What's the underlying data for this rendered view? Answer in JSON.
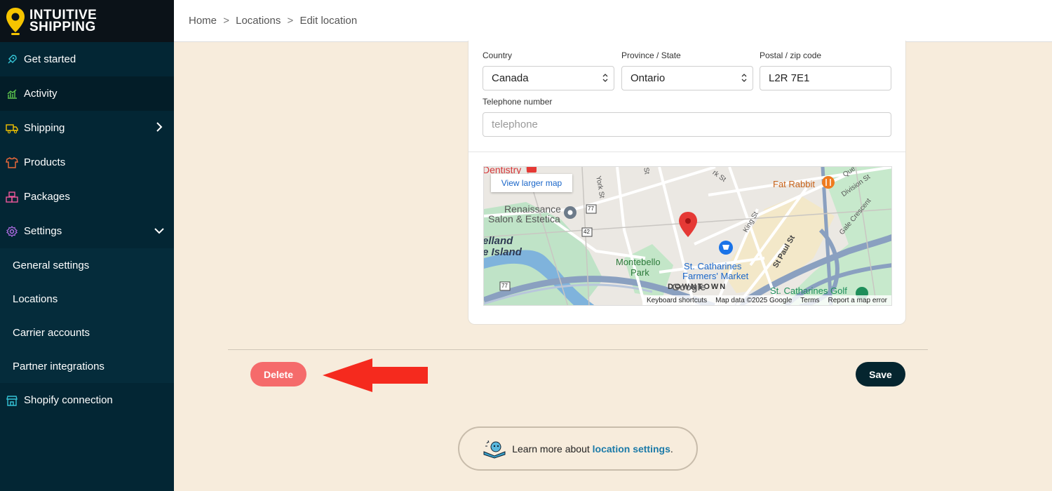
{
  "brand": {
    "line1": "INTUITIVE",
    "line2": "SHIPPING"
  },
  "sidebar": {
    "items": [
      {
        "label": "Get started",
        "icon": "rocket-icon"
      },
      {
        "label": "Activity",
        "icon": "chart-icon"
      },
      {
        "label": "Shipping",
        "icon": "truck-icon"
      },
      {
        "label": "Products",
        "icon": "shirt-icon"
      },
      {
        "label": "Packages",
        "icon": "boxes-icon"
      },
      {
        "label": "Settings",
        "icon": "gear-icon"
      }
    ],
    "subitems": [
      {
        "label": "General settings"
      },
      {
        "label": "Locations"
      },
      {
        "label": "Carrier accounts"
      },
      {
        "label": "Partner integrations"
      }
    ],
    "shopify": {
      "label": "Shopify connection",
      "icon": "store-icon"
    }
  },
  "breadcrumb": {
    "home": "Home",
    "locations": "Locations",
    "current": "Edit location",
    "separator": ">"
  },
  "form": {
    "country": {
      "label": "Country",
      "value": "Canada"
    },
    "province": {
      "label": "Province / State",
      "value": "Ontario"
    },
    "postal": {
      "label": "Postal / zip code",
      "value": "L2R 7E1"
    },
    "telephone": {
      "label": "Telephone number",
      "placeholder": "telephone"
    }
  },
  "map": {
    "view_larger": "View larger map",
    "labels": {
      "dentistry": "Dentistry",
      "renaissance1": "Renaissance",
      "renaissance2": "Salon & Estetica",
      "welland1": "elland",
      "welland2": "e Island",
      "montebello1": "Montebello",
      "montebello2": "Park",
      "market1": "St. Catharines",
      "market2": "Farmers' Market",
      "fatrabbit": "Fat Rabbit",
      "downtown": "DOWNTOWN",
      "golf": "St. Catharines Golf",
      "yorkst": "York St",
      "kingst": "King St",
      "stpaulst": "St Paul St",
      "divisionst": "Division St",
      "gale": "Gale Crescent",
      "que": "Que",
      "rk": "rk St",
      "st": "St",
      "r77a": "77",
      "r42": "42",
      "r77b": "77",
      "google": "Google"
    },
    "footer": {
      "shortcuts": "Keyboard shortcuts",
      "mapdata": "Map data ©2025 Google",
      "terms": "Terms",
      "report": "Report a map error"
    }
  },
  "actions": {
    "delete": "Delete",
    "save": "Save"
  },
  "learn": {
    "prefix": "Learn more about ",
    "link": "location settings",
    "suffix": "."
  },
  "colors": {
    "sidebar": "#032634",
    "page": "#f7ecdc",
    "accent_yellow": "#f5c400",
    "delete": "#f56b6b",
    "save": "#05252f",
    "link": "#1b7aa8",
    "arrow": "#f52a1e"
  }
}
